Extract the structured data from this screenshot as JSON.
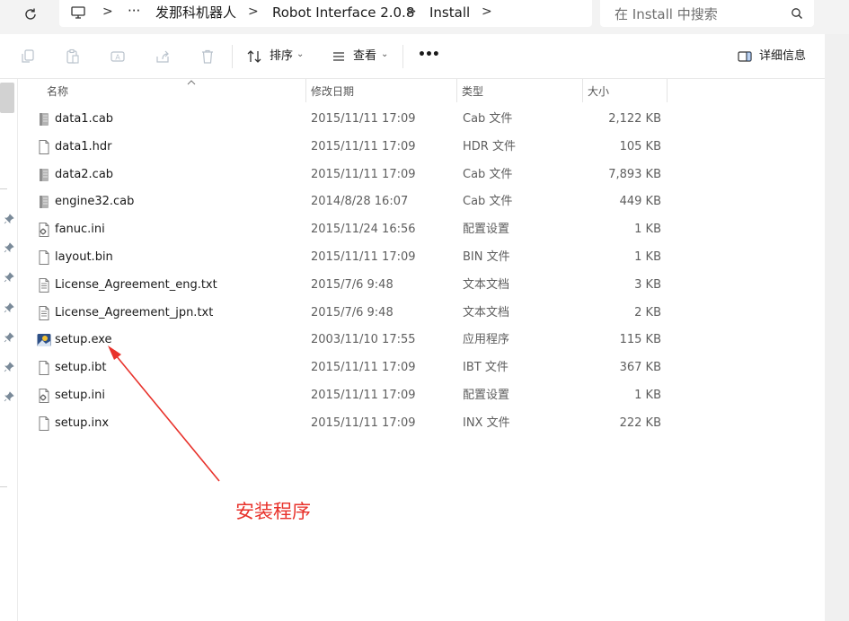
{
  "address_bar": {
    "crumbs": [
      "发那科机器人",
      "Robot Interface 2.0.8",
      "Install"
    ],
    "search_placeholder": "在 Install 中搜索"
  },
  "toolbar": {
    "sort_label": "排序",
    "view_label": "查看",
    "more_label": "•••",
    "details_label": "详细信息"
  },
  "columns": {
    "name": "名称",
    "date": "修改日期",
    "type": "类型",
    "size": "大小"
  },
  "files": [
    {
      "name": "data1.cab",
      "date": "2015/11/11 17:09",
      "type": "Cab 文件",
      "size": "2,122 KB",
      "icon": "cabinet-file-icon"
    },
    {
      "name": "data1.hdr",
      "date": "2015/11/11 17:09",
      "type": "HDR 文件",
      "size": "105 KB",
      "icon": "blank-file-icon"
    },
    {
      "name": "data2.cab",
      "date": "2015/11/11 17:09",
      "type": "Cab 文件",
      "size": "7,893 KB",
      "icon": "cabinet-file-icon"
    },
    {
      "name": "engine32.cab",
      "date": "2014/8/28 16:07",
      "type": "Cab 文件",
      "size": "449 KB",
      "icon": "cabinet-file-icon"
    },
    {
      "name": "fanuc.ini",
      "date": "2015/11/24 16:56",
      "type": "配置设置",
      "size": "1 KB",
      "icon": "config-file-icon"
    },
    {
      "name": "layout.bin",
      "date": "2015/11/11 17:09",
      "type": "BIN 文件",
      "size": "1 KB",
      "icon": "blank-file-icon"
    },
    {
      "name": "License_Agreement_eng.txt",
      "date": "2015/7/6 9:48",
      "type": "文本文档",
      "size": "3 KB",
      "icon": "text-file-icon"
    },
    {
      "name": "License_Agreement_jpn.txt",
      "date": "2015/7/6 9:48",
      "type": "文本文档",
      "size": "2 KB",
      "icon": "text-file-icon"
    },
    {
      "name": "setup.exe",
      "date": "2003/11/10 17:55",
      "type": "应用程序",
      "size": "115 KB",
      "icon": "installer-app-icon"
    },
    {
      "name": "setup.ibt",
      "date": "2015/11/11 17:09",
      "type": "IBT 文件",
      "size": "367 KB",
      "icon": "blank-file-icon"
    },
    {
      "name": "setup.ini",
      "date": "2015/11/11 17:09",
      "type": "配置设置",
      "size": "1 KB",
      "icon": "config-file-icon"
    },
    {
      "name": "setup.inx",
      "date": "2015/11/11 17:09",
      "type": "INX 文件",
      "size": "222 KB",
      "icon": "blank-file-icon"
    }
  ],
  "annotation": {
    "text": "安装程序",
    "color": "#e8322b"
  }
}
